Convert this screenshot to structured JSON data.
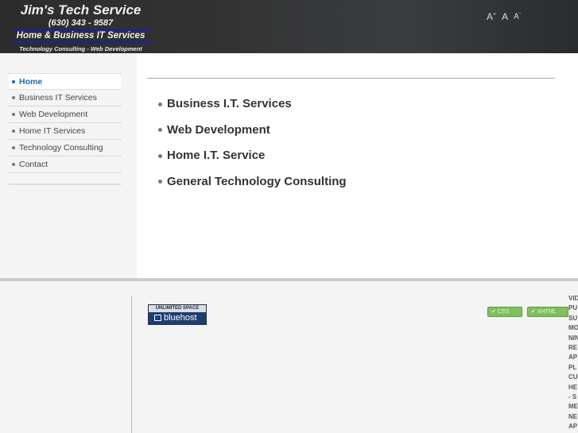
{
  "header": {
    "title": "Jim's Tech Service",
    "phone": "(630) 343 - 9587",
    "tagline": "Home & Business IT Services",
    "subtagline": "Technology Consulting  - Web Development",
    "font_size_controls": [
      {
        "label": "A",
        "sup": "+"
      },
      {
        "label": "A",
        "sup": ""
      },
      {
        "label": "A",
        "sup": "-"
      }
    ]
  },
  "nav": {
    "active": "Home",
    "items": [
      "Home",
      "Business IT Services",
      "Web Development",
      "Home IT Services",
      "Technology Consulting",
      "Contact"
    ]
  },
  "main": {
    "services": [
      "Business I.T. Services",
      "Web Development",
      "Home I.T. Service",
      "General Technology Consulting"
    ]
  },
  "footer": {
    "bluehost_top": "UNLIMITED SPACE",
    "bluehost_name": "bluehost",
    "badges": [
      "CSS",
      "XHTML"
    ],
    "right_list": [
      "VID",
      "PU",
      "SU",
      "MO",
      "NIN",
      "RE",
      "AP",
      "PL",
      "CU",
      "HE",
      "- S",
      "ME",
      "NE",
      "AP"
    ]
  },
  "colors": {
    "accent": "#1c6aa8",
    "header_bg": "#333333",
    "badge_green": "#7fbf5f"
  }
}
